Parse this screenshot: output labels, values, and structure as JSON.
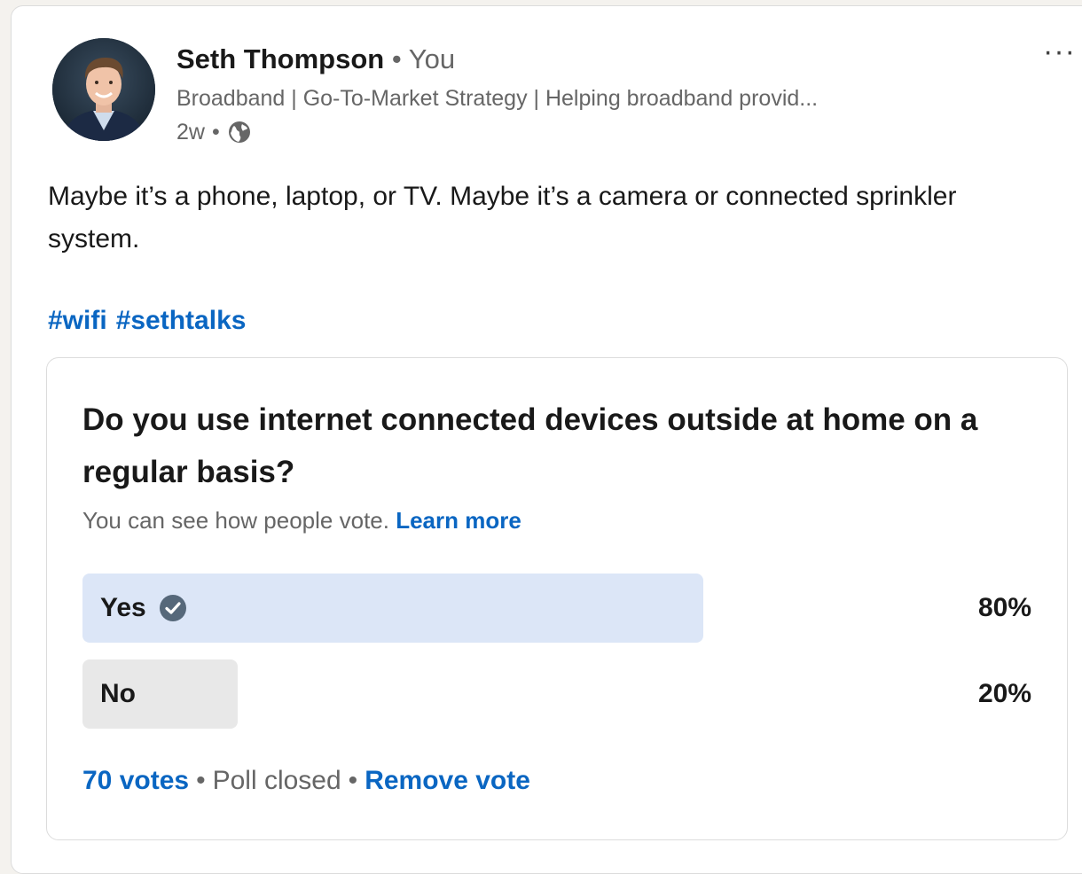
{
  "post": {
    "author": {
      "name": "Seth Thompson",
      "separator": "•",
      "relation": "You",
      "headline": "Broadband | Go-To-Market Strategy | Helping broadband provid...",
      "time": "2w",
      "time_separator": "•",
      "visibility_icon": "globe-icon"
    },
    "more_label": "···",
    "text": "Maybe it’s a phone, laptop, or TV. Maybe it’s a camera or connected sprinkler system.",
    "hashtags": [
      "#wifi",
      "#sethtalks"
    ]
  },
  "poll": {
    "question": "Do you use internet connected devices outside at home on a regular basis?",
    "visibility_text": "You can see how people vote.",
    "learn_more": "Learn more",
    "options": [
      {
        "label": "Yes",
        "percent_label": "80%",
        "percent": 80,
        "selected": true,
        "icon": "check-circle-icon"
      },
      {
        "label": "No",
        "percent_label": "20%",
        "percent": 20,
        "selected": false
      }
    ],
    "votes": "70 votes",
    "status": "Poll closed",
    "remove_vote": "Remove vote",
    "separator": "•"
  },
  "colors": {
    "link": "#0a66c2",
    "selected_bar": "#dce6f7",
    "unselected_bar": "#e8e8e8",
    "muted_text": "#666666"
  }
}
